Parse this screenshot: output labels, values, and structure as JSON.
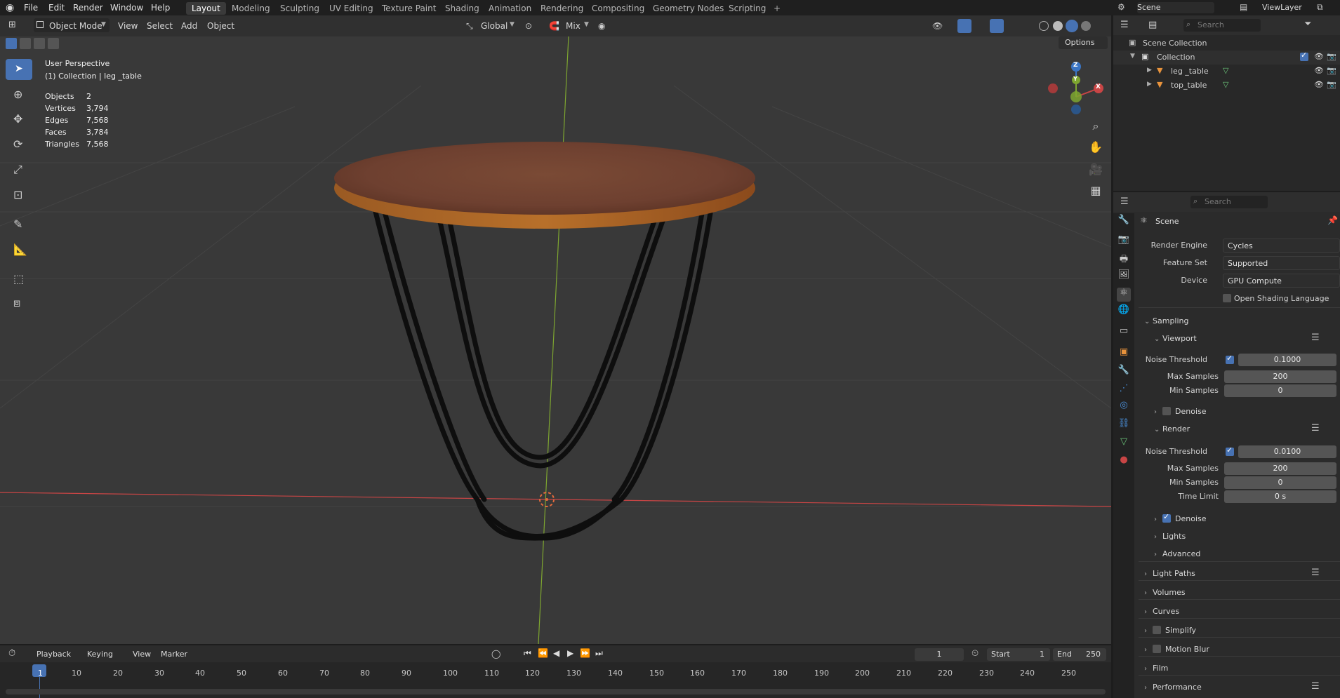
{
  "menu": {
    "items": [
      "File",
      "Edit",
      "Render",
      "Window",
      "Help"
    ]
  },
  "workspaces": {
    "tabs": [
      "Layout",
      "Modeling",
      "Sculpting",
      "UV Editing",
      "Texture Paint",
      "Shading",
      "Animation",
      "Rendering",
      "Compositing",
      "Geometry Nodes",
      "Scripting"
    ],
    "active": "Layout",
    "add": "+"
  },
  "top_right": {
    "scene": "Scene",
    "view_layer": "ViewLayer"
  },
  "viewport_header": {
    "mode": "Object Mode",
    "menus": [
      "View",
      "Select",
      "Add",
      "Object"
    ],
    "transform_orientation": "Global",
    "snap_mode": "Mix",
    "options": "Options"
  },
  "overlay": {
    "view_name": "User Perspective",
    "collection_info": "(1) Collection | leg _table",
    "stats": [
      {
        "label": "Objects",
        "value": "2"
      },
      {
        "label": "Vertices",
        "value": "3,794"
      },
      {
        "label": "Edges",
        "value": "7,568"
      },
      {
        "label": "Faces",
        "value": "3,784"
      },
      {
        "label": "Triangles",
        "value": "7,568"
      }
    ]
  },
  "gizmo": {
    "x": "X",
    "y": "Y",
    "z": "Z"
  },
  "outliner": {
    "search_placeholder": "Search",
    "root": "Scene Collection",
    "collection": "Collection",
    "objects": [
      "leg _table",
      "top_table"
    ]
  },
  "properties": {
    "search_placeholder": "Search",
    "context": "Scene",
    "render_engine_label": "Render Engine",
    "render_engine": "Cycles",
    "feature_set_label": "Feature Set",
    "feature_set": "Supported",
    "device_label": "Device",
    "device": "GPU Compute",
    "osl_label": "Open Shading Language",
    "sampling": "Sampling",
    "viewport": {
      "title": "Viewport",
      "noise_threshold_label": "Noise Threshold",
      "noise_threshold": "0.1000",
      "max_samples_label": "Max Samples",
      "max_samples": "200",
      "min_samples_label": "Min Samples",
      "min_samples": "0",
      "denoise_label": "Denoise"
    },
    "render": {
      "title": "Render",
      "noise_threshold_label": "Noise Threshold",
      "noise_threshold": "0.0100",
      "max_samples_label": "Max Samples",
      "max_samples": "200",
      "min_samples_label": "Min Samples",
      "min_samples": "0",
      "time_limit_label": "Time Limit",
      "time_limit": "0 s",
      "denoise_label": "Denoise",
      "lights": "Lights",
      "advanced": "Advanced"
    },
    "panels": [
      "Light Paths",
      "Volumes",
      "Curves",
      "Simplify",
      "Motion Blur",
      "Film",
      "Performance"
    ]
  },
  "timeline": {
    "menus": [
      "Playback",
      "Keying",
      "View",
      "Marker"
    ],
    "current_frame": "1",
    "start_label": "Start",
    "start": "1",
    "end_label": "End",
    "end": "250",
    "ruler": [
      "1",
      "10",
      "20",
      "30",
      "40",
      "50",
      "60",
      "70",
      "80",
      "90",
      "100",
      "110",
      "120",
      "130",
      "140",
      "150",
      "160",
      "170",
      "180",
      "190",
      "200",
      "210",
      "220",
      "230",
      "240",
      "250"
    ]
  },
  "colors": {
    "accent": "#4772b3",
    "axis_x": "#c94545",
    "axis_y": "#7ea630",
    "axis_z": "#3a75c4",
    "wood": "#8a4a22"
  }
}
